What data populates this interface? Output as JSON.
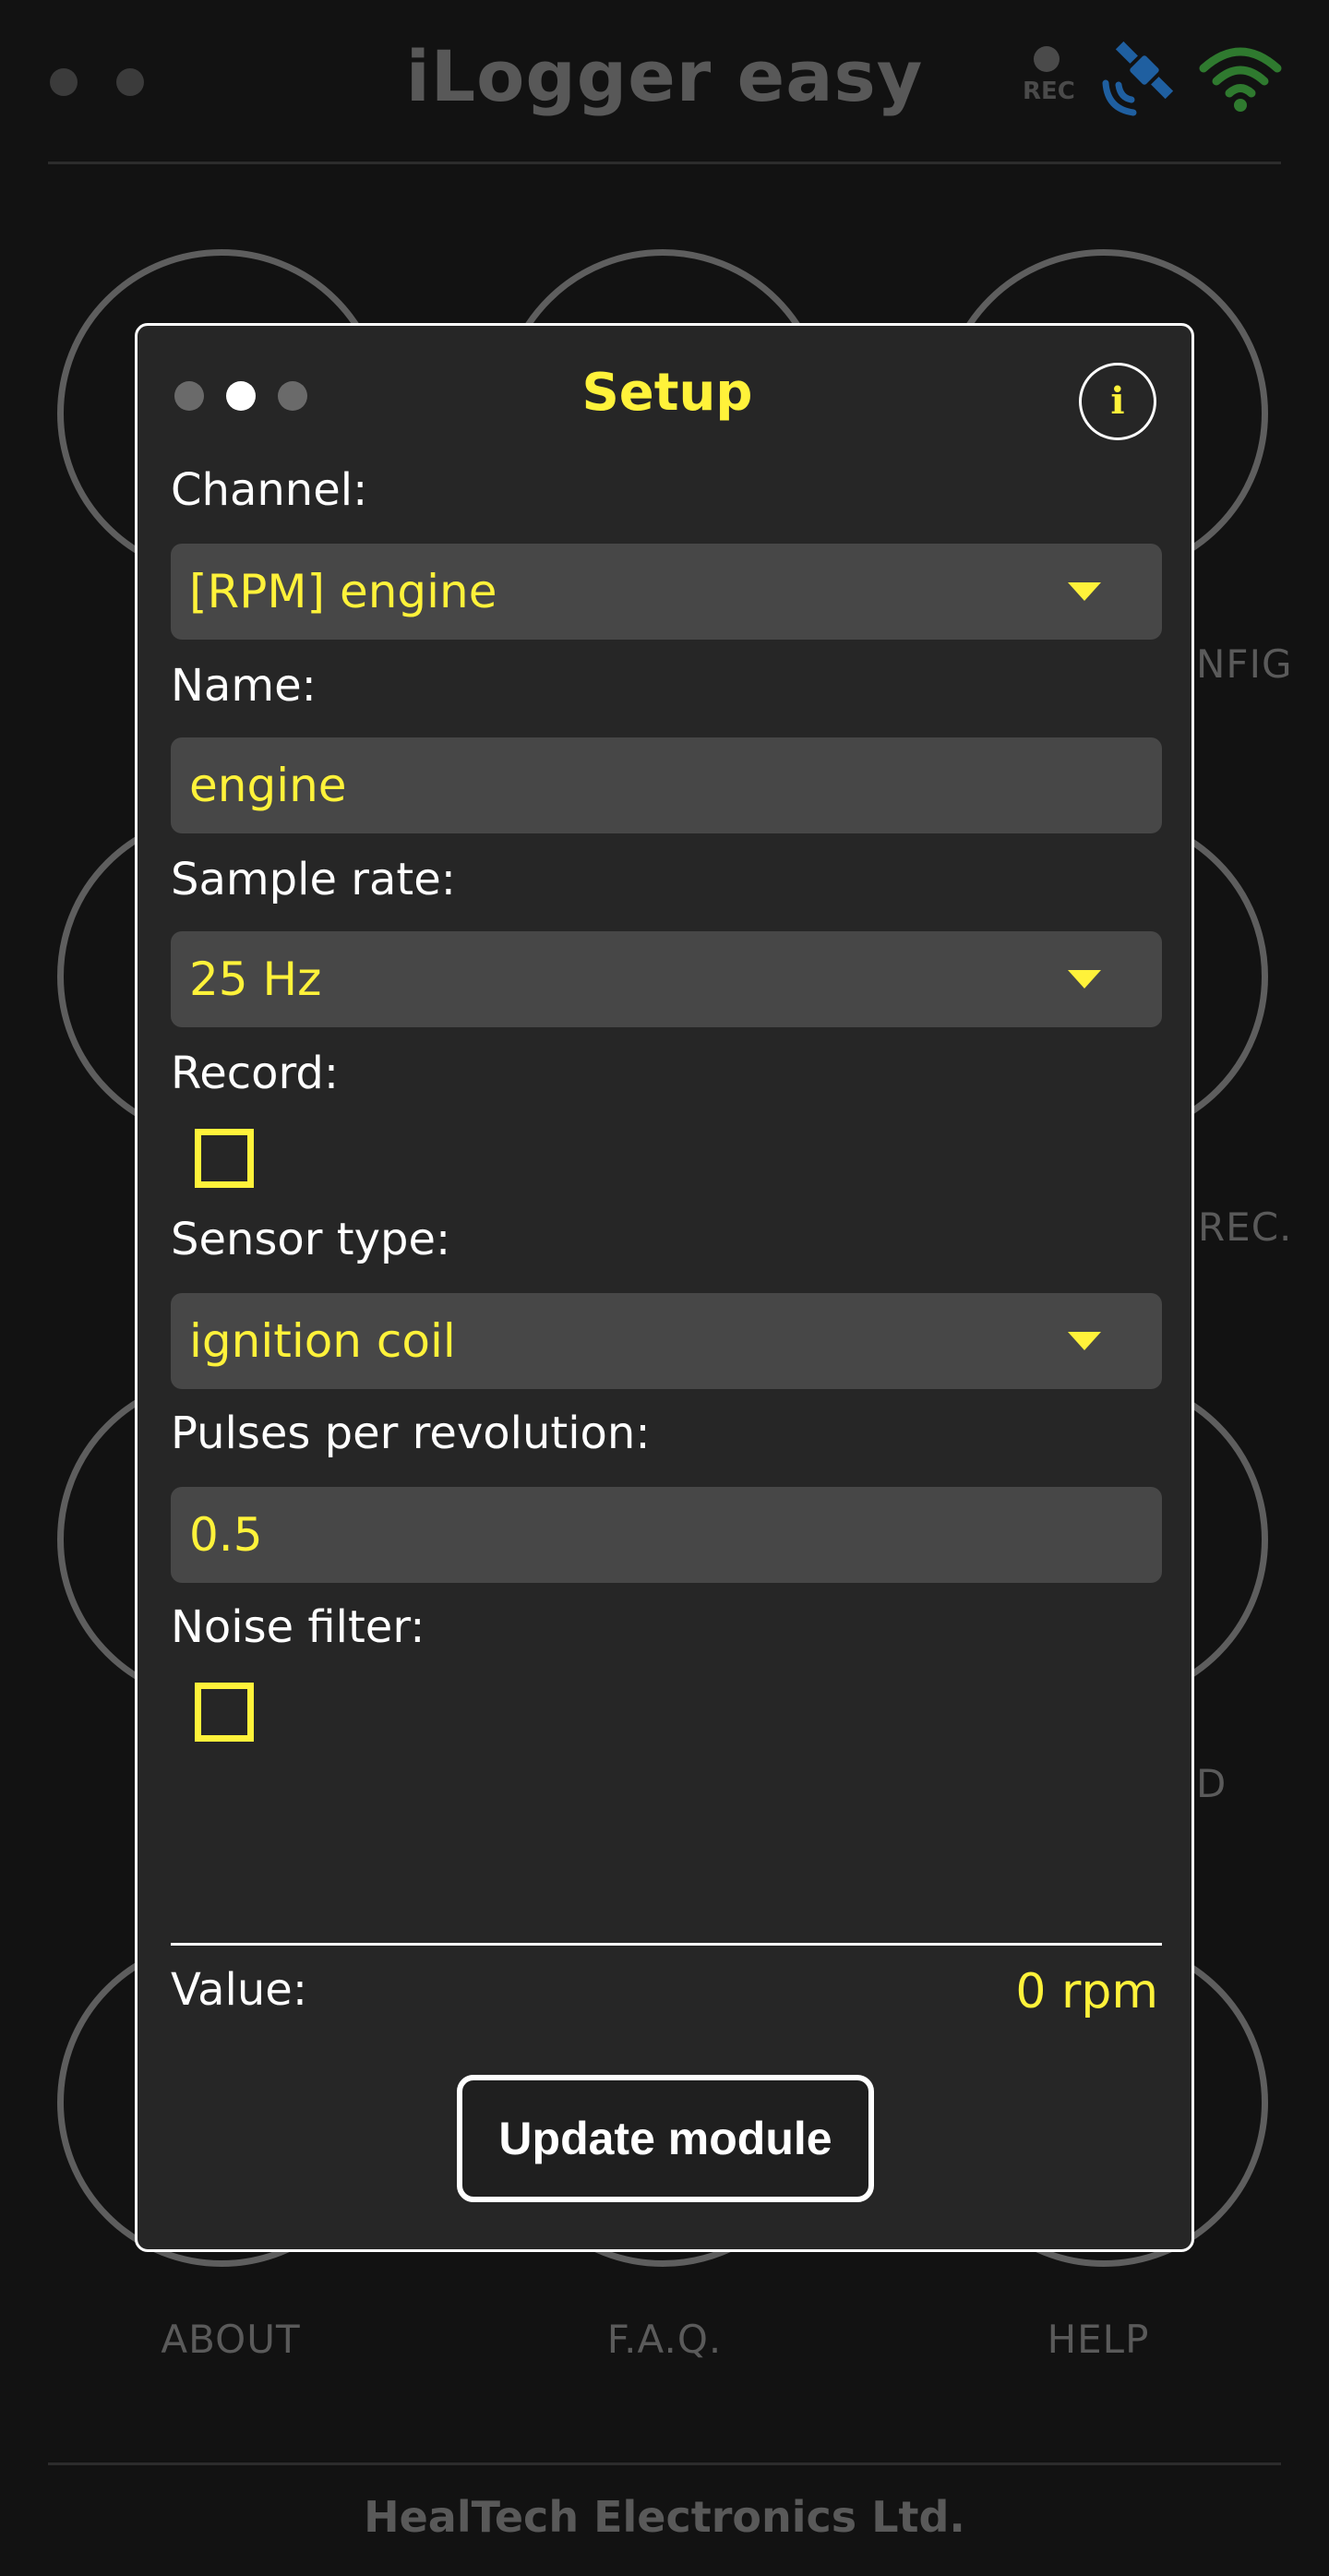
{
  "app": {
    "title": "iLogger easy",
    "rec_label": "REC",
    "footer": "HealTech Electronics Ltd."
  },
  "background_menu": {
    "labels": [
      "ABOUT",
      "F.A.Q.",
      "HELP"
    ],
    "partial_labels": [
      "NFIG",
      "REC.",
      "D"
    ]
  },
  "colors": {
    "accent": "#fff23a",
    "background": "#121212",
    "dialog": "#262626",
    "field": "#474747",
    "satellite": "#1f5fa0",
    "wifi": "#2f7a2f"
  },
  "icons": {
    "rec": "rec-indicator-icon",
    "gps": "satellite-icon",
    "wifi": "wifi-icon",
    "info": "info-icon",
    "dropdown": "chevron-down-icon"
  },
  "dialog": {
    "title": "Setup",
    "info_symbol": "i",
    "page_indicator": {
      "pages": 3,
      "active": 2
    },
    "channel": {
      "label": "Channel:",
      "value": "[RPM] engine"
    },
    "name": {
      "label": "Name:",
      "value": "engine"
    },
    "sample_rate": {
      "label": "Sample rate:",
      "value": "25 Hz"
    },
    "record": {
      "label": "Record:",
      "checked": false
    },
    "sensor_type": {
      "label": "Sensor type:",
      "value": "ignition coil"
    },
    "pulses": {
      "label": "Pulses per revolution:",
      "value": "0.5"
    },
    "noise_filter": {
      "label": "Noise filter:",
      "checked": false
    },
    "value": {
      "label": "Value:",
      "text": "0 rpm"
    },
    "update_button": "Update module"
  }
}
